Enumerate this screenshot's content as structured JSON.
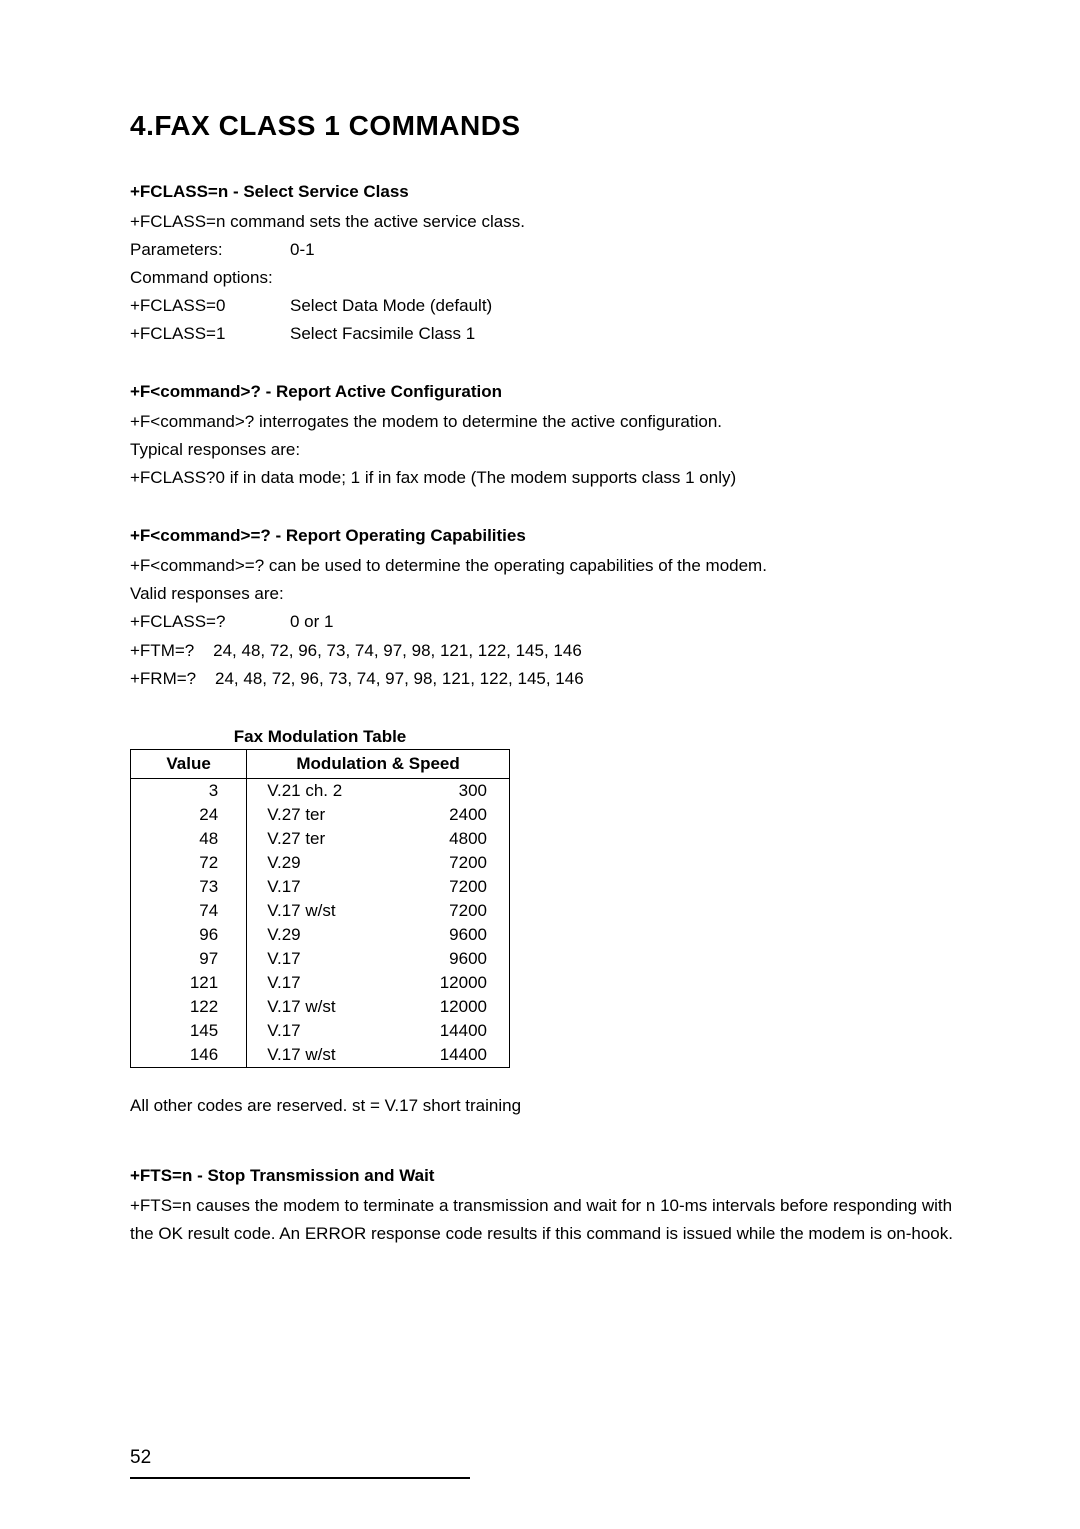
{
  "heading": "4.FAX CLASS 1 COMMANDS",
  "section1": {
    "title": "+FCLASS=n - Select Service Class",
    "desc": "+FCLASS=n command sets the active service class.",
    "rows": [
      {
        "k": "Parameters:",
        "v": "0-1"
      },
      {
        "k": "Command options:",
        "v": ""
      },
      {
        "k": "+FCLASS=0",
        "v": "Select Data Mode (default)"
      },
      {
        "k": "+FCLASS=1",
        "v": "Select Facsimile Class 1"
      }
    ]
  },
  "section2": {
    "title": "+F<command>? - Report Active Configuration",
    "lines": [
      "+F<command>? interrogates the modem to determine the active configuration.",
      "Typical responses are:",
      "+FCLASS?0 if in data mode; 1 if in fax mode (The modem supports class 1 only)"
    ]
  },
  "section3": {
    "title": "+F<command>=? - Report Operating Capabilities",
    "lines": [
      "+F<command>=? can be used to determine the operating capabilities of the modem.",
      "Valid responses are:"
    ],
    "rows": [
      {
        "k": "+FCLASS=?",
        "v": "0 or 1"
      }
    ],
    "lines2": [
      "+FTM=?    24, 48, 72, 96, 73, 74, 97, 98, 121, 122, 145, 146",
      "+FRM=?    24, 48, 72, 96, 73, 74, 97, 98, 121, 122, 145, 146"
    ]
  },
  "table": {
    "caption": "Fax Modulation Table",
    "headers": {
      "c1": "Value",
      "c2": "Modulation & Speed"
    }
  },
  "chart_data": {
    "type": "table",
    "title": "Fax Modulation Table",
    "columns": [
      "Value",
      "Modulation",
      "Speed"
    ],
    "rows": [
      {
        "value": "3",
        "modulation": "V.21 ch. 2",
        "speed": "300"
      },
      {
        "value": "24",
        "modulation": "V.27 ter",
        "speed": "2400"
      },
      {
        "value": "48",
        "modulation": "V.27 ter",
        "speed": "4800"
      },
      {
        "value": "72",
        "modulation": "V.29",
        "speed": "7200"
      },
      {
        "value": "73",
        "modulation": "V.17",
        "speed": "7200"
      },
      {
        "value": "74",
        "modulation": "V.17 w/st",
        "speed": "7200"
      },
      {
        "value": "96",
        "modulation": "V.29",
        "speed": "9600"
      },
      {
        "value": "97",
        "modulation": "V.17",
        "speed": "9600"
      },
      {
        "value": "121",
        "modulation": "V.17",
        "speed": "12000"
      },
      {
        "value": "122",
        "modulation": "V.17 w/st",
        "speed": "12000"
      },
      {
        "value": "145",
        "modulation": "V.17",
        "speed": "14400"
      },
      {
        "value": "146",
        "modulation": "V.17 w/st",
        "speed": "14400"
      }
    ]
  },
  "footnote": "All other codes are reserved.  st = V.17 short training",
  "section4": {
    "title": "+FTS=n - Stop Transmission and Wait",
    "desc": "+FTS=n causes the modem to terminate a transmission and wait for n 10-ms intervals before responding with the OK result code. An ERROR response code results if this command is issued while the modem is on-hook."
  },
  "page_number": "52"
}
